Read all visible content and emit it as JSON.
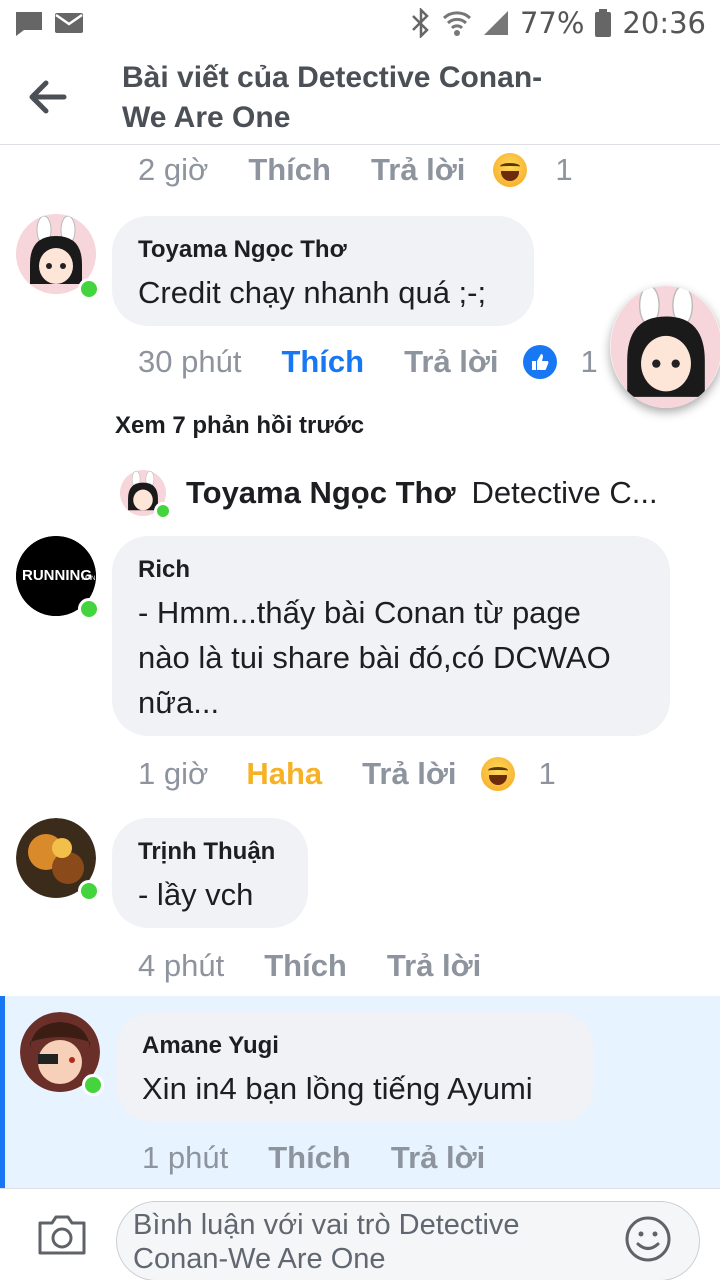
{
  "status_bar": {
    "battery_percent": "77%",
    "time": "20:36",
    "icons": [
      "message-icon",
      "mail-icon",
      "bluetooth-icon",
      "wifi-icon",
      "signal-icon",
      "battery-icon"
    ]
  },
  "header": {
    "title_line1": "Bài viết của Detective Conan-",
    "title_line2": "We Are One"
  },
  "comments": [
    {
      "meta": {
        "time": "2 giờ",
        "like": "Thích",
        "reply": "Trả lời",
        "reaction": "haha",
        "count": "1"
      }
    },
    {
      "author": "Toyama Ngọc Thơ",
      "text": "Credit chạy nhanh quá ;-;",
      "meta": {
        "time": "30 phút",
        "like": "Thích",
        "reply": "Trả lời",
        "reaction": "like",
        "count": "1"
      }
    },
    {
      "view_previous": "Xem 7 phản hồi trước",
      "reply_preview": {
        "author": "Toyama Ngọc Thơ",
        "text": "Detective C..."
      }
    },
    {
      "author": "Rich",
      "text_lines": [
        "- Hmm...thấy bài Conan từ page",
        "nào là tui share bài đó,có DCWAO",
        "nữa..."
      ],
      "meta": {
        "time": "1 giờ",
        "like": "Haha",
        "reply": "Trả lời",
        "reaction": "haha",
        "count": "1"
      }
    },
    {
      "author": "Trịnh Thuận",
      "text": "- lầy vch",
      "meta": {
        "time": "4 phút",
        "like": "Thích",
        "reply": "Trả lời"
      }
    },
    {
      "author": "Amane Yugi",
      "text": "Xin in4 bạn lồng tiếng Ayumi",
      "meta": {
        "time": "1 phút",
        "like": "Thích",
        "reply": "Trả lời"
      }
    }
  ],
  "avatar_labels": {
    "running_man": "RUNNING",
    "running_man_small": "MAN"
  },
  "composer": {
    "placeholder_line1": "Bình luận với vai trò Detective",
    "placeholder_line2": "Conan-We Are One"
  },
  "colors": {
    "facebook_blue": "#1877f2",
    "haha_yellow": "#f7b125",
    "online_green": "#44d43d",
    "bubble_gray": "#f0f2f5",
    "highlight_blue": "#e7f3ff"
  }
}
